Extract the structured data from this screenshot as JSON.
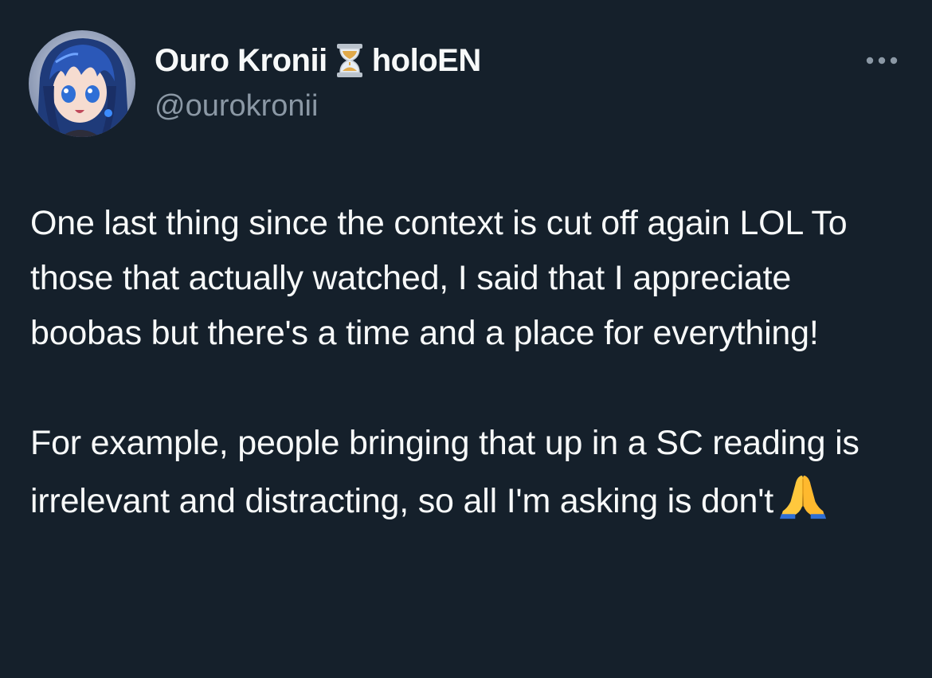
{
  "author": {
    "name": "Ouro Kronii",
    "badge_icon": "hourglass-icon",
    "affiliation": "holoEN",
    "handle": "@ourokronii",
    "avatar_icon": "anime-avatar"
  },
  "menu": {
    "more_icon": "more-horizontal-icon"
  },
  "tweet": {
    "paragraphs": [
      "One last thing since the context is cut off again LOL To those that actually watched, I said that I appreciate boobas but there's a time and a place for everything!",
      "For example, people bringing that up in a SC reading is irrelevant and distracting, so all I'm asking is don't"
    ],
    "trailing_emoji_icon": "folded-hands-emoji"
  },
  "colors": {
    "background": "#15202b",
    "text": "#f7f9f9",
    "secondary_text": "#8b98a5"
  }
}
